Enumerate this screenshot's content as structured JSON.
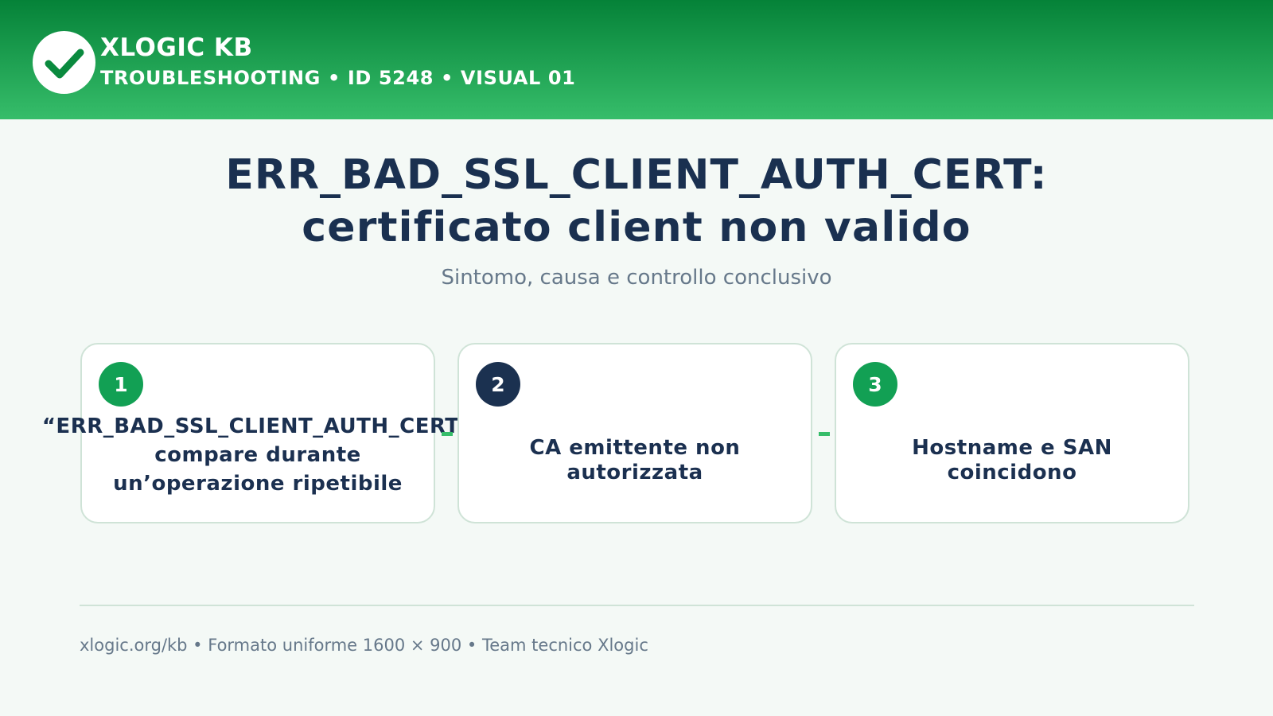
{
  "header": {
    "brand": "XLOGIC KB",
    "subtitle": "TROUBLESHOOTING • ID 5248 • VISUAL 01",
    "logo_icon": "checkmark-icon"
  },
  "title": {
    "line1": "ERR_BAD_SSL_CLIENT_AUTH_CERT:",
    "line2": "certificato client non valido",
    "subtitle": "Sintomo, causa e controllo conclusivo"
  },
  "steps": [
    {
      "number": "1",
      "text": "“ERR_BAD_SSL_CLIENT_AUTH_CERT”\ncompare durante\nun’operazione ripetibile",
      "badge_color": "#12a054"
    },
    {
      "number": "2",
      "text": "CA emittente non\nautorizzata",
      "badge_color": "#1b3150"
    },
    {
      "number": "3",
      "text": "Hostname e SAN\ncoincidono",
      "badge_color": "#12a054"
    }
  ],
  "footer": {
    "text": "xlogic.org/kb • Formato uniforme 1600 × 900 • Team tecnico Xlogic"
  },
  "colors": {
    "brand_green": "#12a054",
    "header_top": "#058238",
    "header_bottom": "#36bd6a",
    "navy": "#1b3150",
    "background": "#f4f9f6"
  }
}
